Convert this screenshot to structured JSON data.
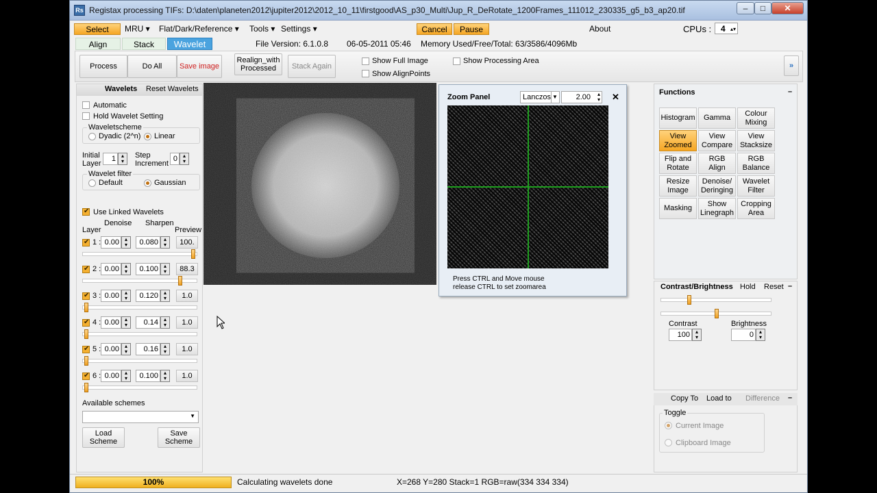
{
  "window": {
    "title": "Registax processing TIFs: D:\\daten\\planeten2012\\jupiter2012\\2012_10_11\\firstgood\\AS_p30_Multi\\Jup_R_DeRotate_1200Frames_111012_230335_g5_b3_ap20.tif",
    "app_icon": "Rs",
    "minimize_icon": "minimize-icon",
    "maximize_icon": "maximize-icon",
    "close_icon": "close-icon"
  },
  "menu": {
    "select": "Select",
    "mru": "MRU",
    "flat": "Flat/Dark/Reference",
    "tools": "Tools",
    "settings": "Settings",
    "cancel": "Cancel",
    "pause": "Pause",
    "about": "About",
    "cpus_label": "CPUs :",
    "cpus_value": "4",
    "file_version": "File Version: 6.1.0.8",
    "file_date": "06-05-2011 05:46",
    "memory": "Memory Used/Free/Total: 63/3586/4096Mb"
  },
  "tabs": [
    "Align",
    "Stack",
    "Wavelet"
  ],
  "toolbar": {
    "process": "Process",
    "do_all": "Do All",
    "save_image": "Save image",
    "realign_1": "Realign_with",
    "realign_2": "Processed",
    "stack_again": "Stack Again",
    "show_full_image": "Show Full Image",
    "show_alignpoints": "Show AlignPoints",
    "show_processing_area": "Show Processing Area",
    "expand": "»"
  },
  "wavelets": {
    "title": "Wavelets",
    "reset": "Reset Wavelets",
    "automatic": "Automatic",
    "hold": "Hold Wavelet Setting",
    "scheme_label": "Waveletscheme",
    "dyadic": "Dyadic (2^n)",
    "linear": "Linear",
    "initial_layer_1": "Initial",
    "initial_layer_2": "Layer",
    "initial_layer_value": "1",
    "step_1": "Step",
    "step_2": "Increment",
    "step_value": "0",
    "filter_label": "Wavelet filter",
    "default": "Default",
    "gaussian": "Gaussian",
    "use_linked": "Use Linked Wavelets",
    "col_layer": "Layer",
    "col_denoise": "Denoise",
    "col_sharpen": "Sharpen",
    "col_preview": "Preview",
    "layers": [
      {
        "n": "1",
        "denoise": "0.00",
        "sharpen": "0.080",
        "preview": "100.",
        "slider": 1.0
      },
      {
        "n": "2",
        "denoise": "0.00",
        "sharpen": "0.100",
        "preview": "88.3",
        "slider": 0.88
      },
      {
        "n": "3",
        "denoise": "0.00",
        "sharpen": "0.120",
        "preview": "1.0",
        "slider": 0.01
      },
      {
        "n": "4",
        "denoise": "0.00",
        "sharpen": "0.14",
        "preview": "1.0",
        "slider": 0.01
      },
      {
        "n": "5",
        "denoise": "0.00",
        "sharpen": "0.16",
        "preview": "1.0",
        "slider": 0.01
      },
      {
        "n": "6",
        "denoise": "0.00",
        "sharpen": "0.100",
        "preview": "1.0",
        "slider": 0.01
      }
    ],
    "available_schemes": "Available schemes",
    "load_1": "Load",
    "load_2": "Scheme",
    "save_1": "Save",
    "save_2": "Scheme"
  },
  "zoom": {
    "title": "Zoom Panel",
    "method": "Lanczos",
    "factor": "2.00",
    "hint_1": "Press CTRL and Move mouse",
    "hint_2": "release CTRL to set zoomarea"
  },
  "functions": {
    "title": "Functions",
    "buttons": [
      [
        "Histogram"
      ],
      [
        "Gamma"
      ],
      [
        "Colour",
        "Mixing"
      ],
      [
        "View",
        "Zoomed"
      ],
      [
        "View",
        "Compare"
      ],
      [
        "View",
        "Stacksize"
      ],
      [
        "Flip and",
        "Rotate"
      ],
      [
        "RGB",
        "Align"
      ],
      [
        "RGB",
        "Balance"
      ],
      [
        "Resize",
        "Image"
      ],
      [
        "Denoise/",
        "Deringing"
      ],
      [
        "Wavelet",
        "Filter"
      ],
      [
        "Masking"
      ],
      [
        "Show",
        "Linegraph"
      ],
      [
        "Cropping",
        "Area"
      ]
    ]
  },
  "contrast": {
    "title": "Contrast/Brightness",
    "hold": "Hold",
    "reset": "Reset",
    "contrast_label": "Contrast",
    "contrast_value": "100",
    "brightness_label": "Brightness",
    "brightness_value": "0"
  },
  "copy": {
    "copy_to": "Copy To",
    "load_to": "Load to",
    "difference": "Difference",
    "toggle": "Toggle",
    "current_image": "Current Image",
    "clipboard_image": "Clipboard Image"
  },
  "status": {
    "progress": "100%",
    "progress_value": 1.0,
    "message": "Calculating wavelets done",
    "coords": "X=268 Y=280 Stack=1 RGB=raw(334 334 334)"
  }
}
